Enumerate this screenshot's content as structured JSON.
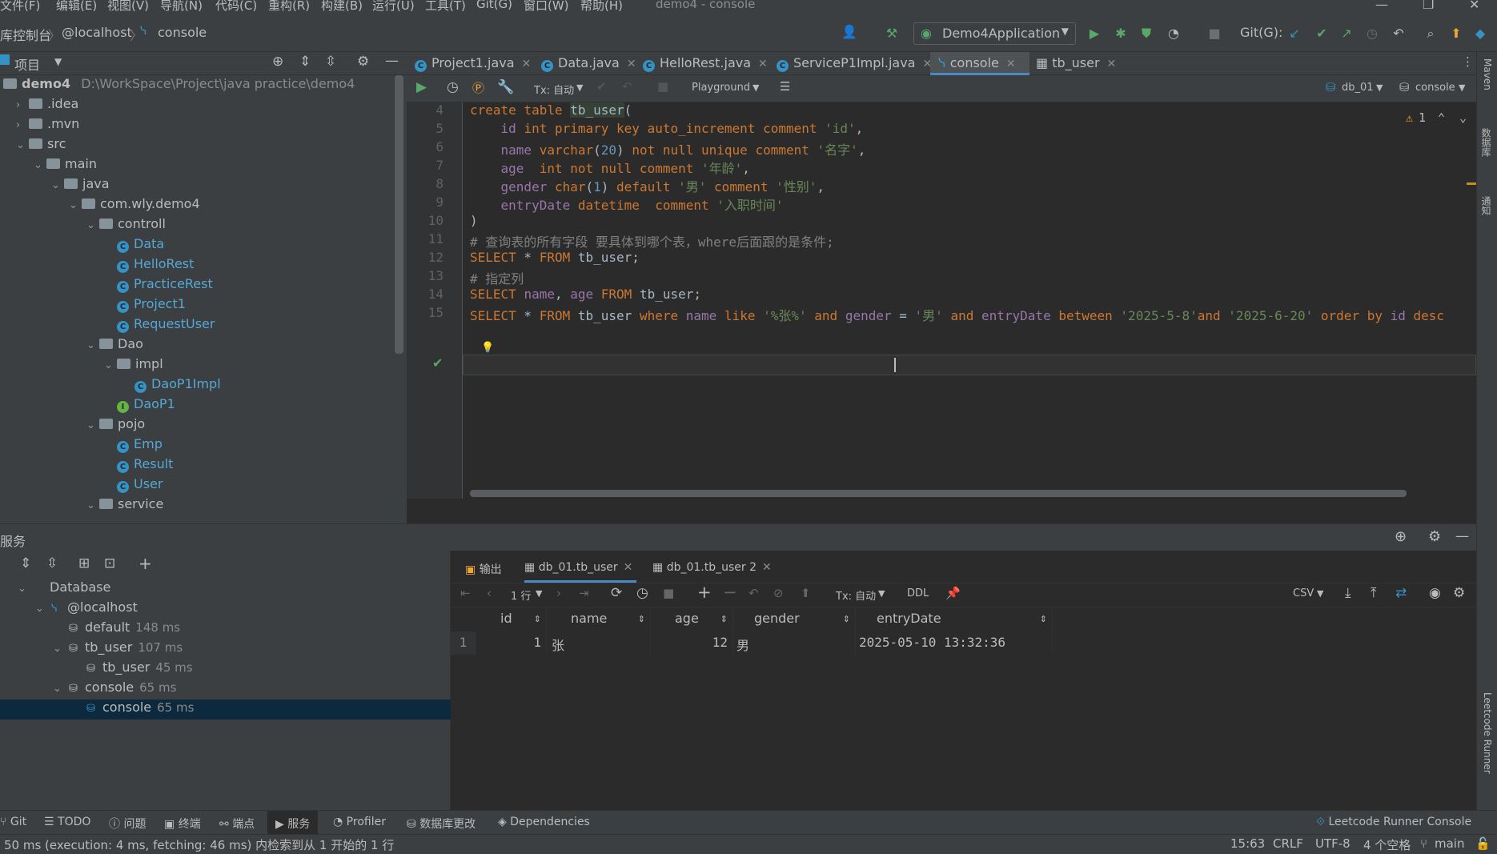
{
  "menu": [
    "文件(F)",
    "编辑(E)",
    "视图(V)",
    "导航(N)",
    "代码(C)",
    "重构(R)",
    "构建(B)",
    "运行(U)",
    "工具(T)",
    "Git(G)",
    "窗口(W)",
    "帮助(H)"
  ],
  "window_title": "demo4 - console",
  "breadcrumb": [
    "库控制台",
    "@localhost",
    "console"
  ],
  "run_config": "Demo4Application",
  "git_label": "Git(G):",
  "project_panel": {
    "title": "项目",
    "root": {
      "name": "demo4",
      "path": "D:\\WorkSpace\\Project\\java practice\\demo4"
    },
    "items": [
      {
        "label": ".idea",
        "kind": "folder",
        "depth": 1,
        "chev": ">"
      },
      {
        "label": ".mvn",
        "kind": "folder",
        "depth": 1,
        "chev": ">"
      },
      {
        "label": "src",
        "kind": "folder",
        "depth": 1,
        "chev": "v"
      },
      {
        "label": "main",
        "kind": "folder",
        "depth": 2,
        "chev": "v"
      },
      {
        "label": "java",
        "kind": "folder",
        "depth": 3,
        "chev": "v"
      },
      {
        "label": "com.wly.demo4",
        "kind": "folder",
        "depth": 4,
        "chev": "v"
      },
      {
        "label": "controll",
        "kind": "folder",
        "depth": 5,
        "chev": "v"
      },
      {
        "label": "Data",
        "kind": "class",
        "depth": 6
      },
      {
        "label": "HelloRest",
        "kind": "class",
        "depth": 6
      },
      {
        "label": "PracticeRest",
        "kind": "class",
        "depth": 6
      },
      {
        "label": "Project1",
        "kind": "class",
        "depth": 6
      },
      {
        "label": "RequestUser",
        "kind": "class",
        "depth": 6
      },
      {
        "label": "Dao",
        "kind": "folder",
        "depth": 5,
        "chev": "v"
      },
      {
        "label": "impl",
        "kind": "folder",
        "depth": 6,
        "chev": "v"
      },
      {
        "label": "DaoP1Impl",
        "kind": "class",
        "depth": 7
      },
      {
        "label": "DaoP1",
        "kind": "interface",
        "depth": 6
      },
      {
        "label": "pojo",
        "kind": "folder",
        "depth": 5,
        "chev": "v"
      },
      {
        "label": "Emp",
        "kind": "class",
        "depth": 6
      },
      {
        "label": "Result",
        "kind": "class",
        "depth": 6
      },
      {
        "label": "User",
        "kind": "class",
        "depth": 6
      },
      {
        "label": "service",
        "kind": "folder",
        "depth": 5,
        "chev": "v"
      }
    ]
  },
  "editor_tabs": [
    {
      "label": "Project1.java",
      "icon": "C",
      "active": false
    },
    {
      "label": "Data.java",
      "icon": "C",
      "active": false
    },
    {
      "label": "HelloRest.java",
      "icon": "C",
      "active": false
    },
    {
      "label": "ServiceP1Impl.java",
      "icon": "C",
      "active": false
    },
    {
      "label": "console",
      "icon": "console",
      "active": true
    },
    {
      "label": "tb_user",
      "icon": "table",
      "active": false
    }
  ],
  "editor_toolbar": {
    "tx": "Tx: 自动",
    "playground": "Playground",
    "schema": "db_01",
    "session": "console",
    "warning_count": "1"
  },
  "code_lines": [
    {
      "n": "4",
      "html": "<span class='kw'>create table</span> <span style='background:#344134'>tb_user</span>("
    },
    {
      "n": "5",
      "html": "    <span class='fld'>id</span> <span class='kw'>int primary key auto_increment comment</span> <span class='str'>'id'</span>,"
    },
    {
      "n": "6",
      "html": "    <span class='fld'>name</span> <span class='kw'>varchar</span>(<span class='num'>20</span>) <span class='kw'>not null unique comment</span> <span class='str'>'名字'</span>,"
    },
    {
      "n": "7",
      "html": "    <span class='fld'>age</span>  <span class='kw'>int not null comment</span> <span class='str'>'年龄'</span>,"
    },
    {
      "n": "8",
      "html": "    <span class='fld'>gender</span> <span class='kw'>char</span>(<span class='num'>1</span>) <span class='kw'>default</span> <span class='str'>'男'</span> <span class='kw'>comment</span> <span class='str'>'性别'</span>,"
    },
    {
      "n": "9",
      "html": "    <span class='fld'>entryDate</span> <span class='kw'>datetime</span>  <span class='kw'>comment</span> <span class='str'>'入职时间'</span>"
    },
    {
      "n": "10",
      "html": ")"
    },
    {
      "n": "11",
      "html": "<span class='cmt'># 查询表的所有字段 要具体到哪个表，where后面跟的是条件;</span>"
    },
    {
      "n": "12",
      "html": "<span class='kw'>SELECT</span> * <span class='kw'>FROM</span> tb_user;"
    },
    {
      "n": "13",
      "html": "<span class='cmt'># 指定列</span>"
    },
    {
      "n": "14",
      "html": "<span class='kw'>SELECT</span> <span class='fld'>name</span>, <span class='fld'>age</span> <span class='kw'>FROM</span> tb_user;"
    },
    {
      "n": "15",
      "html": "<span class='kw'>SELECT</span> * <span class='kw'>FROM</span> tb_user <span class='kw'>where</span> <span class='fld'>name</span> <span class='kw'>like</span> <span class='str'>'%张%'</span> <span class='kw'>and</span> <span class='fld'>gender</span> = <span class='str'>'男'</span> <span class='kw'>and</span> <span class='fld'>entryDate</span> <span class='kw'>between</span> <span class='str'>'2025-5-8'</span><span class='kw'>and</span> <span class='str'>'2025-6-20'</span> <span class='kw'>order by</span> <span class='fld'>id</span> <span class='kw'>desc</span>"
    }
  ],
  "services": {
    "title": "服务",
    "tree": [
      {
        "label": "Database",
        "ms": "",
        "depth": 1,
        "chev": "v"
      },
      {
        "label": "@localhost",
        "ms": "",
        "depth": 2,
        "chev": "v"
      },
      {
        "label": "default",
        "ms": "148 ms",
        "depth": 3,
        "chev": ""
      },
      {
        "label": "tb_user",
        "ms": "107 ms",
        "depth": 3,
        "chev": "v"
      },
      {
        "label": "tb_user",
        "ms": "45 ms",
        "depth": 4,
        "chev": ""
      },
      {
        "label": "console",
        "ms": "65 ms",
        "depth": 3,
        "chev": "v"
      },
      {
        "label": "console",
        "ms": "65 ms",
        "depth": 4,
        "chev": "",
        "selected": true
      }
    ]
  },
  "results": {
    "tabs": [
      "输出",
      "db_01.tb_user",
      "db_01.tb_user 2"
    ],
    "rows_label": "1 行",
    "tx": "Tx: 自动",
    "ddl": "DDL",
    "export": "CSV",
    "columns": [
      "id",
      "name",
      "age",
      "gender",
      "entryDate"
    ],
    "rows": [
      [
        "1",
        "1",
        "张",
        "12",
        "男",
        "2025-05-10 13:32:36"
      ]
    ]
  },
  "bottom_tabs": [
    "Git",
    "TODO",
    "问题",
    "终端",
    "端点",
    "服务",
    "Profiler",
    "数据库更改",
    "Dependencies"
  ],
  "leetcode": "Leetcode Runner Console",
  "right_strip": [
    "Maven",
    "数据库",
    "通知",
    "Leetcode Runner"
  ],
  "status": {
    "message": "50 ms (execution: 4 ms, fetching: 46 ms) 内检索到从 1 开始的 1 行",
    "position": "15:63",
    "eol": "CRLF",
    "encoding": "UTF-8",
    "indent": "4 个空格",
    "branch": "main"
  }
}
